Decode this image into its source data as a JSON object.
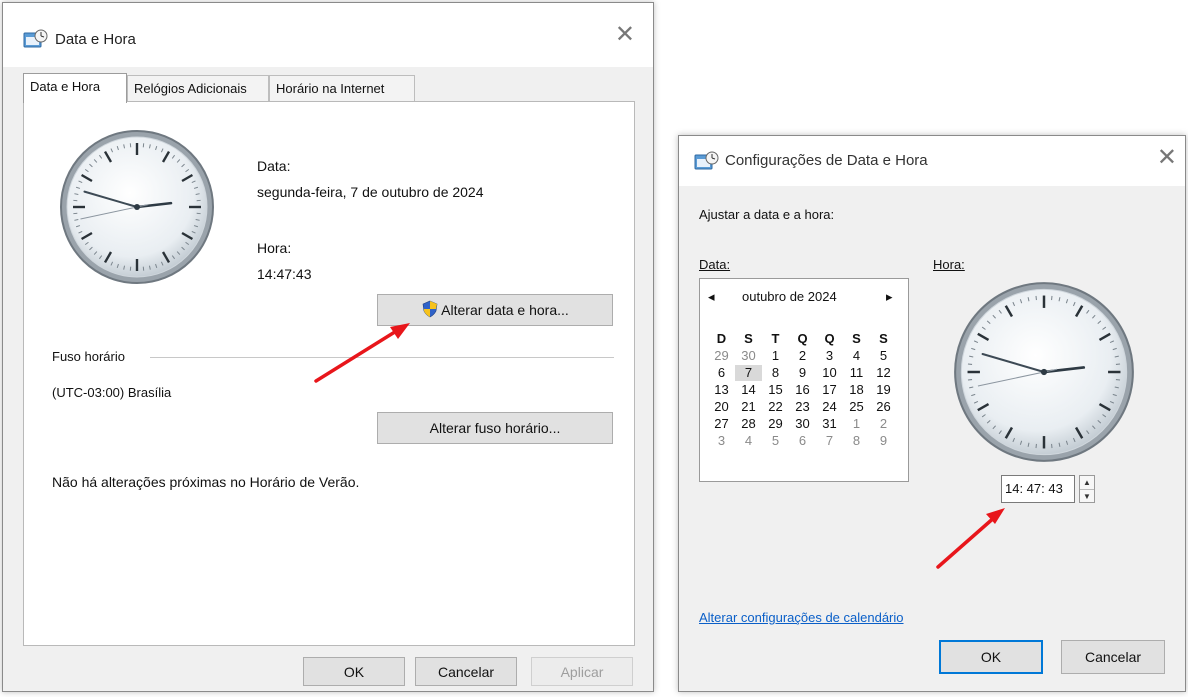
{
  "main_window": {
    "title": "Data e Hora",
    "close_glyph": "✕",
    "tabs": [
      {
        "label": "Data e Hora",
        "active": true
      },
      {
        "label": "Relógios Adicionais",
        "active": false
      },
      {
        "label": "Horário na Internet",
        "active": false
      }
    ],
    "date_label": "Data:",
    "date_value": "segunda-feira, 7 de outubro de 2024",
    "time_label": "Hora:",
    "time_value": "14:47:43",
    "change_datetime_button": "Alterar data e hora...",
    "timezone_section": "Fuso horário",
    "timezone_value": "(UTC-03:00) Brasília",
    "change_timezone_button": "Alterar fuso horário...",
    "dst_message": "Não há alterações próximas no Horário de Verão.",
    "ok_button": "OK",
    "cancel_button": "Cancelar",
    "apply_button": "Aplicar"
  },
  "settings_window": {
    "title": "Configurações de Data e Hora",
    "close_glyph": "✕",
    "instruction": "Ajustar a data e a hora:",
    "date_label": "Data:",
    "time_label": "Hora:",
    "calendar": {
      "month_year": "outubro de 2024",
      "prev_glyph": "◂",
      "next_glyph": "▸",
      "weekdays": [
        "D",
        "S",
        "T",
        "Q",
        "Q",
        "S",
        "S"
      ],
      "weeks": [
        [
          "29",
          "30",
          "1",
          "2",
          "3",
          "4",
          "5"
        ],
        [
          "6",
          "7",
          "8",
          "9",
          "10",
          "11",
          "12"
        ],
        [
          "13",
          "14",
          "15",
          "16",
          "17",
          "18",
          "19"
        ],
        [
          "20",
          "21",
          "22",
          "23",
          "24",
          "25",
          "26"
        ],
        [
          "27",
          "28",
          "29",
          "30",
          "31",
          "1",
          "2"
        ],
        [
          "3",
          "4",
          "5",
          "6",
          "7",
          "8",
          "9"
        ]
      ],
      "selected_day": "7"
    },
    "time_input_value": "14: 47: 43",
    "spin_up": "▲",
    "spin_down": "▼",
    "calendar_settings_link": "Alterar configurações de calendário",
    "ok_button": "OK",
    "cancel_button": "Cancelar"
  },
  "colors": {
    "annotation_arrow": "#e8161b",
    "link": "#0a5fc8",
    "focus_border": "#0078d7"
  },
  "clock": {
    "hours": 14,
    "minutes": 47,
    "seconds": 43
  }
}
